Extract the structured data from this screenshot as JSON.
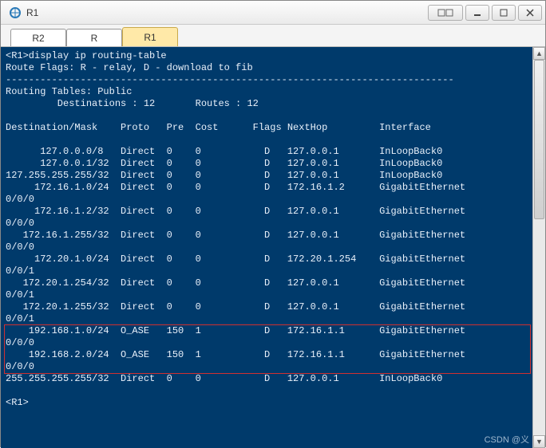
{
  "window": {
    "title": "R1"
  },
  "tabs": [
    {
      "label": "R2",
      "active": false
    },
    {
      "label": "R",
      "active": false
    },
    {
      "label": "R1",
      "active": true
    }
  ],
  "terminal": {
    "prompt_cmd": "<R1>display ip routing-table",
    "flags_line": "Route Flags: R - relay, D - download to fib",
    "divider": "------------------------------------------------------------------------------",
    "table_header": "Routing Tables: Public",
    "summary_line": "         Destinations : 12       Routes : 12",
    "columns_line": "Destination/Mask    Proto   Pre  Cost      Flags NextHop         Interface",
    "rows": [
      {
        "line": "      127.0.0.0/8   Direct  0    0           D   127.0.0.1       InLoopBack0",
        "cont": null
      },
      {
        "line": "      127.0.0.1/32  Direct  0    0           D   127.0.0.1       InLoopBack0",
        "cont": null
      },
      {
        "line": "127.255.255.255/32  Direct  0    0           D   127.0.0.1       InLoopBack0",
        "cont": null
      },
      {
        "line": "     172.16.1.0/24  Direct  0    0           D   172.16.1.2      GigabitEthernet",
        "cont": "0/0/0"
      },
      {
        "line": "     172.16.1.2/32  Direct  0    0           D   127.0.0.1       GigabitEthernet",
        "cont": "0/0/0"
      },
      {
        "line": "   172.16.1.255/32  Direct  0    0           D   127.0.0.1       GigabitEthernet",
        "cont": "0/0/0"
      },
      {
        "line": "     172.20.1.0/24  Direct  0    0           D   172.20.1.254    GigabitEthernet",
        "cont": "0/0/1"
      },
      {
        "line": "   172.20.1.254/32  Direct  0    0           D   127.0.0.1       GigabitEthernet",
        "cont": "0/0/1"
      },
      {
        "line": "   172.20.1.255/32  Direct  0    0           D   127.0.0.1       GigabitEthernet",
        "cont": "0/0/1"
      },
      {
        "line": "    192.168.1.0/24  O_ASE   150  1           D   172.16.1.1      GigabitEthernet",
        "cont": "0/0/0",
        "hl": true
      },
      {
        "line": "    192.168.2.0/24  O_ASE   150  1           D   172.16.1.1      GigabitEthernet",
        "cont": "0/0/0",
        "hl": true
      },
      {
        "line": "255.255.255.255/32  Direct  0    0           D   127.0.0.1       InLoopBack0",
        "cont": null
      }
    ],
    "final_prompt": "<R1>"
  },
  "watermark": "CSDN @义"
}
